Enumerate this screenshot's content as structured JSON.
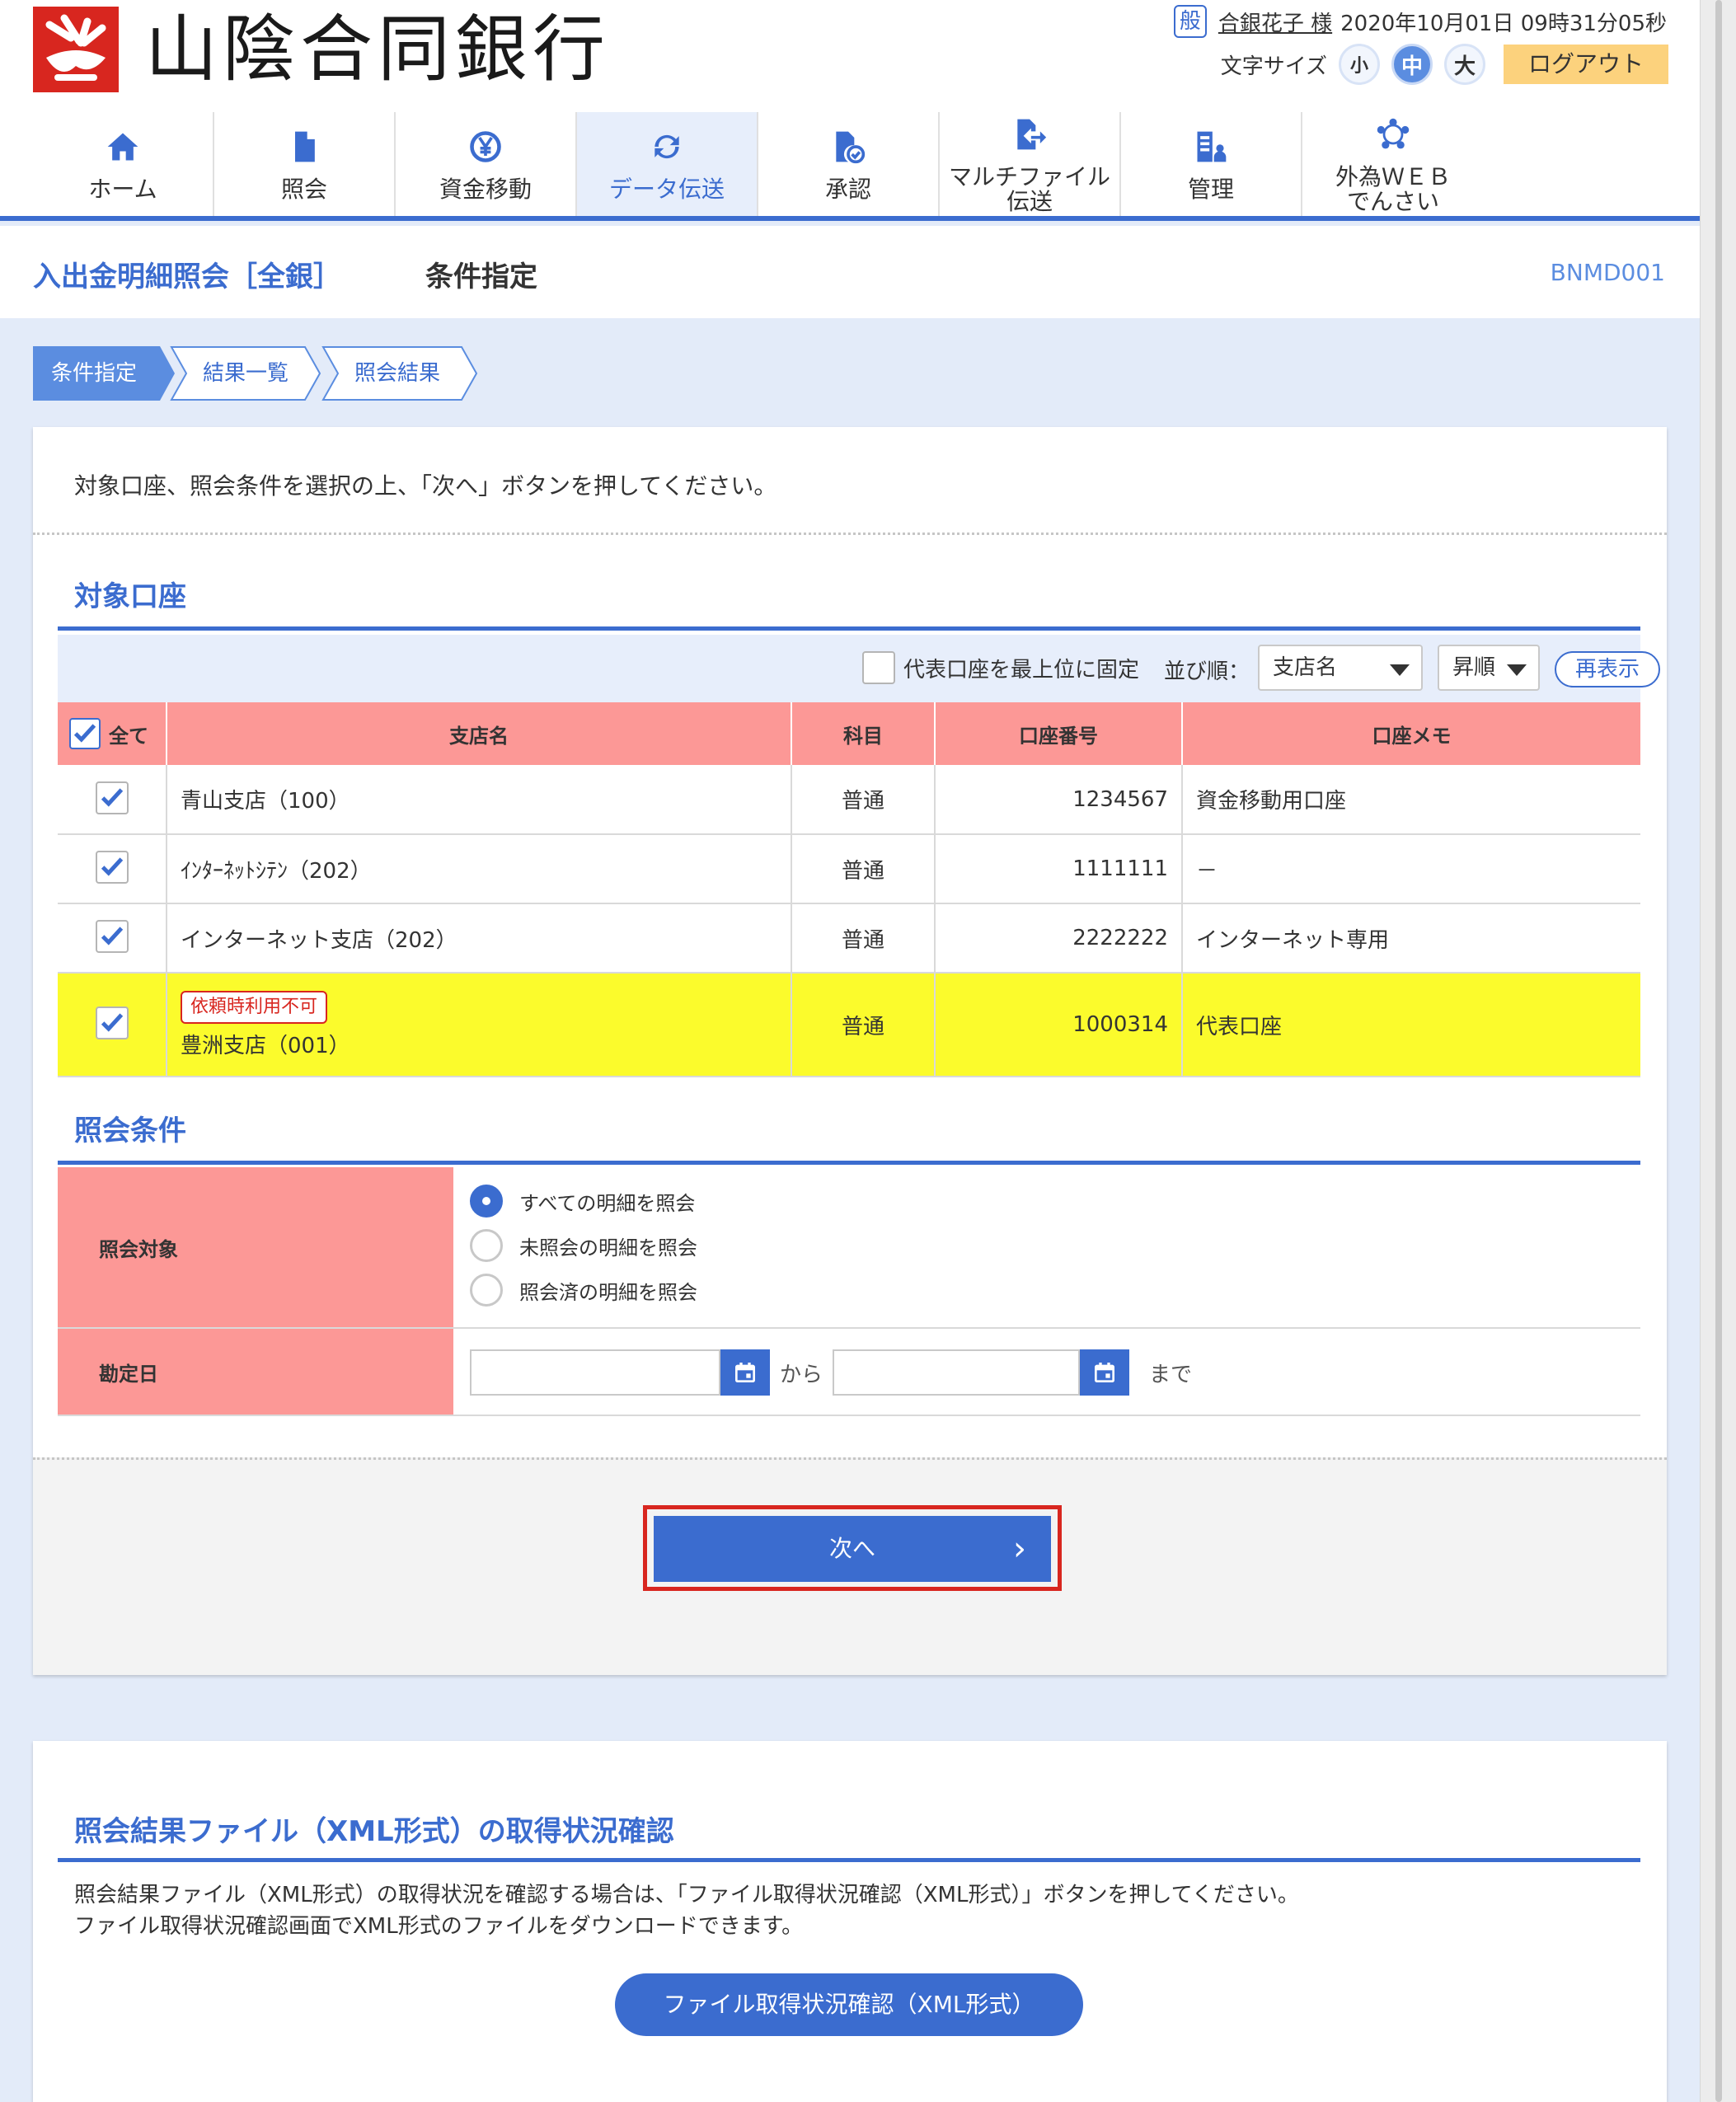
{
  "header": {
    "bank_name": "山陰合同銀行",
    "user_badge": "般",
    "user_name": "合銀花子 様",
    "datetime": "2020年10月01日 09時31分05秒",
    "font_size_label": "文字サイズ",
    "font_sizes": [
      "小",
      "中",
      "大"
    ],
    "logout": "ログアウト"
  },
  "nav": [
    {
      "label": "ホーム",
      "icon": "home-icon"
    },
    {
      "label": "照会",
      "icon": "document-icon"
    },
    {
      "label": "資金移動",
      "icon": "yen-transfer-icon"
    },
    {
      "label": "データ伝送",
      "icon": "refresh-icon",
      "active": true
    },
    {
      "label": "承認",
      "icon": "approve-document-icon"
    },
    {
      "label": "マルチファイル",
      "label2": "伝送",
      "icon": "file-send-icon"
    },
    {
      "label": "管理",
      "icon": "admin-icon"
    },
    {
      "label": "外為ＷＥＢ",
      "label2": "でんさい",
      "icon": "network-icon"
    }
  ],
  "page": {
    "title": "入出金明細照会［全銀］",
    "subtitle": "条件指定",
    "screen_code": "BNMD001"
  },
  "steps": [
    "条件指定",
    "結果一覧",
    "照会結果"
  ],
  "instruction": "対象口座、照会条件を選択の上、「次へ」ボタンを押してください。",
  "accounts_section": {
    "title": "対象口座",
    "pin_label": "代表口座を最上位に固定",
    "sort_label": "並び順：",
    "sort_field": "支店名",
    "sort_order": "昇順",
    "redisplay": "再表示",
    "headers": {
      "all": "全て",
      "branch": "支店名",
      "kamoku": "科目",
      "number": "口座番号",
      "memo": "口座メモ"
    },
    "rows": [
      {
        "branch": "青山支店（100）",
        "kamoku": "普通",
        "number": "1234567",
        "memo": "資金移動用口座"
      },
      {
        "branch": "ｲﾝﾀｰﾈｯﾄｼﾃﾝ（202）",
        "kamoku": "普通",
        "number": "1111111",
        "memo": "－"
      },
      {
        "branch": "インターネット支店（202）",
        "kamoku": "普通",
        "number": "2222222",
        "memo": "インターネット専用"
      },
      {
        "tag": "依頼時利用不可",
        "branch": "豊洲支店（001）",
        "kamoku": "普通",
        "number": "1000314",
        "memo": "代表口座"
      }
    ]
  },
  "conditions_section": {
    "title": "照会条件",
    "target_label": "照会対象",
    "options": [
      "すべての明細を照会",
      "未照会の明細を照会",
      "照会済の明細を照会"
    ],
    "selected_option": "すべての明細を照会",
    "date_label": "勘定日",
    "from_value": "",
    "to_value": "",
    "from_text": "から",
    "to_text": "まで"
  },
  "next_button": "次へ",
  "xml_section": {
    "title": "照会結果ファイル（XML形式）の取得状況確認",
    "desc1": "照会結果ファイル（XML形式）の取得状況を確認する場合は、「ファイル取得状況確認（XML形式）」ボタンを押してください。",
    "desc2": "ファイル取得状況確認画面でXML形式のファイルをダウンロードできます。",
    "button": "ファイル取得状況確認（XML形式）"
  },
  "colors": {
    "accent": "#3b6ccf",
    "header_bg": "#fc9896",
    "highlight": "#fbfb2c",
    "alert": "#d8261f",
    "logout": "#fcd27d"
  }
}
